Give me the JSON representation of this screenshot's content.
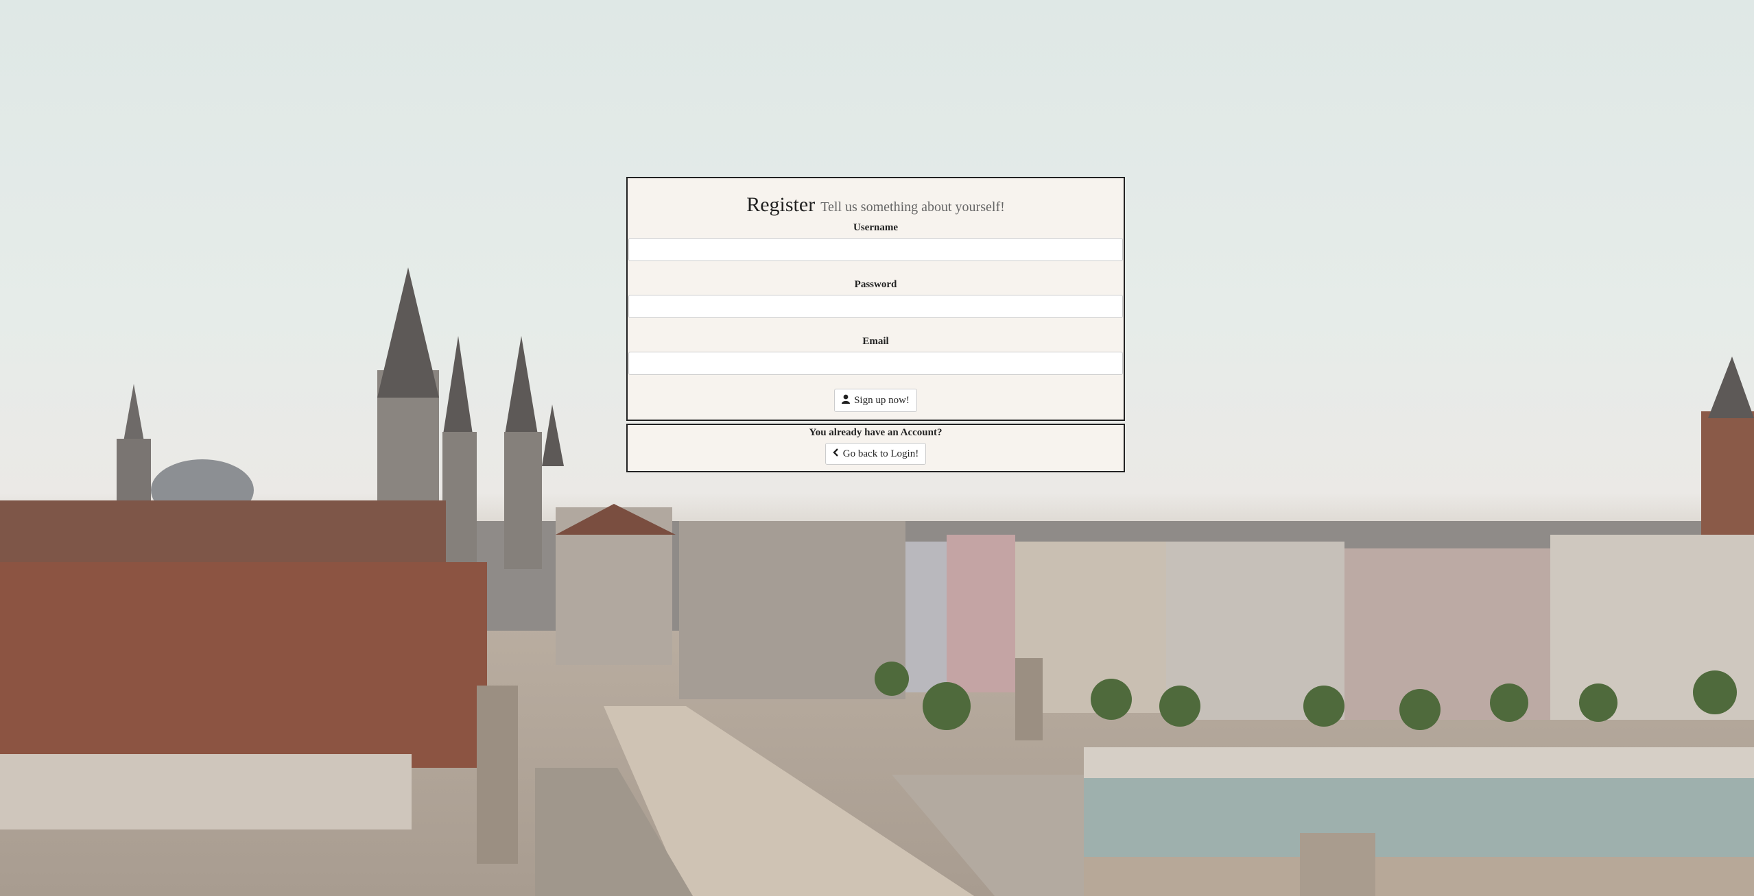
{
  "register": {
    "title": "Register",
    "subtitle": "Tell us something about yourself!",
    "username_label": "Username",
    "username_value": "",
    "password_label": "Password",
    "password_value": "",
    "email_label": "Email",
    "email_value": "",
    "signup_label": "Sign up now!"
  },
  "login": {
    "question": "You already have an Account?",
    "back_label": "Go back to Login!"
  },
  "icons": {
    "signup": "user-icon",
    "back": "chevron-left-icon"
  }
}
